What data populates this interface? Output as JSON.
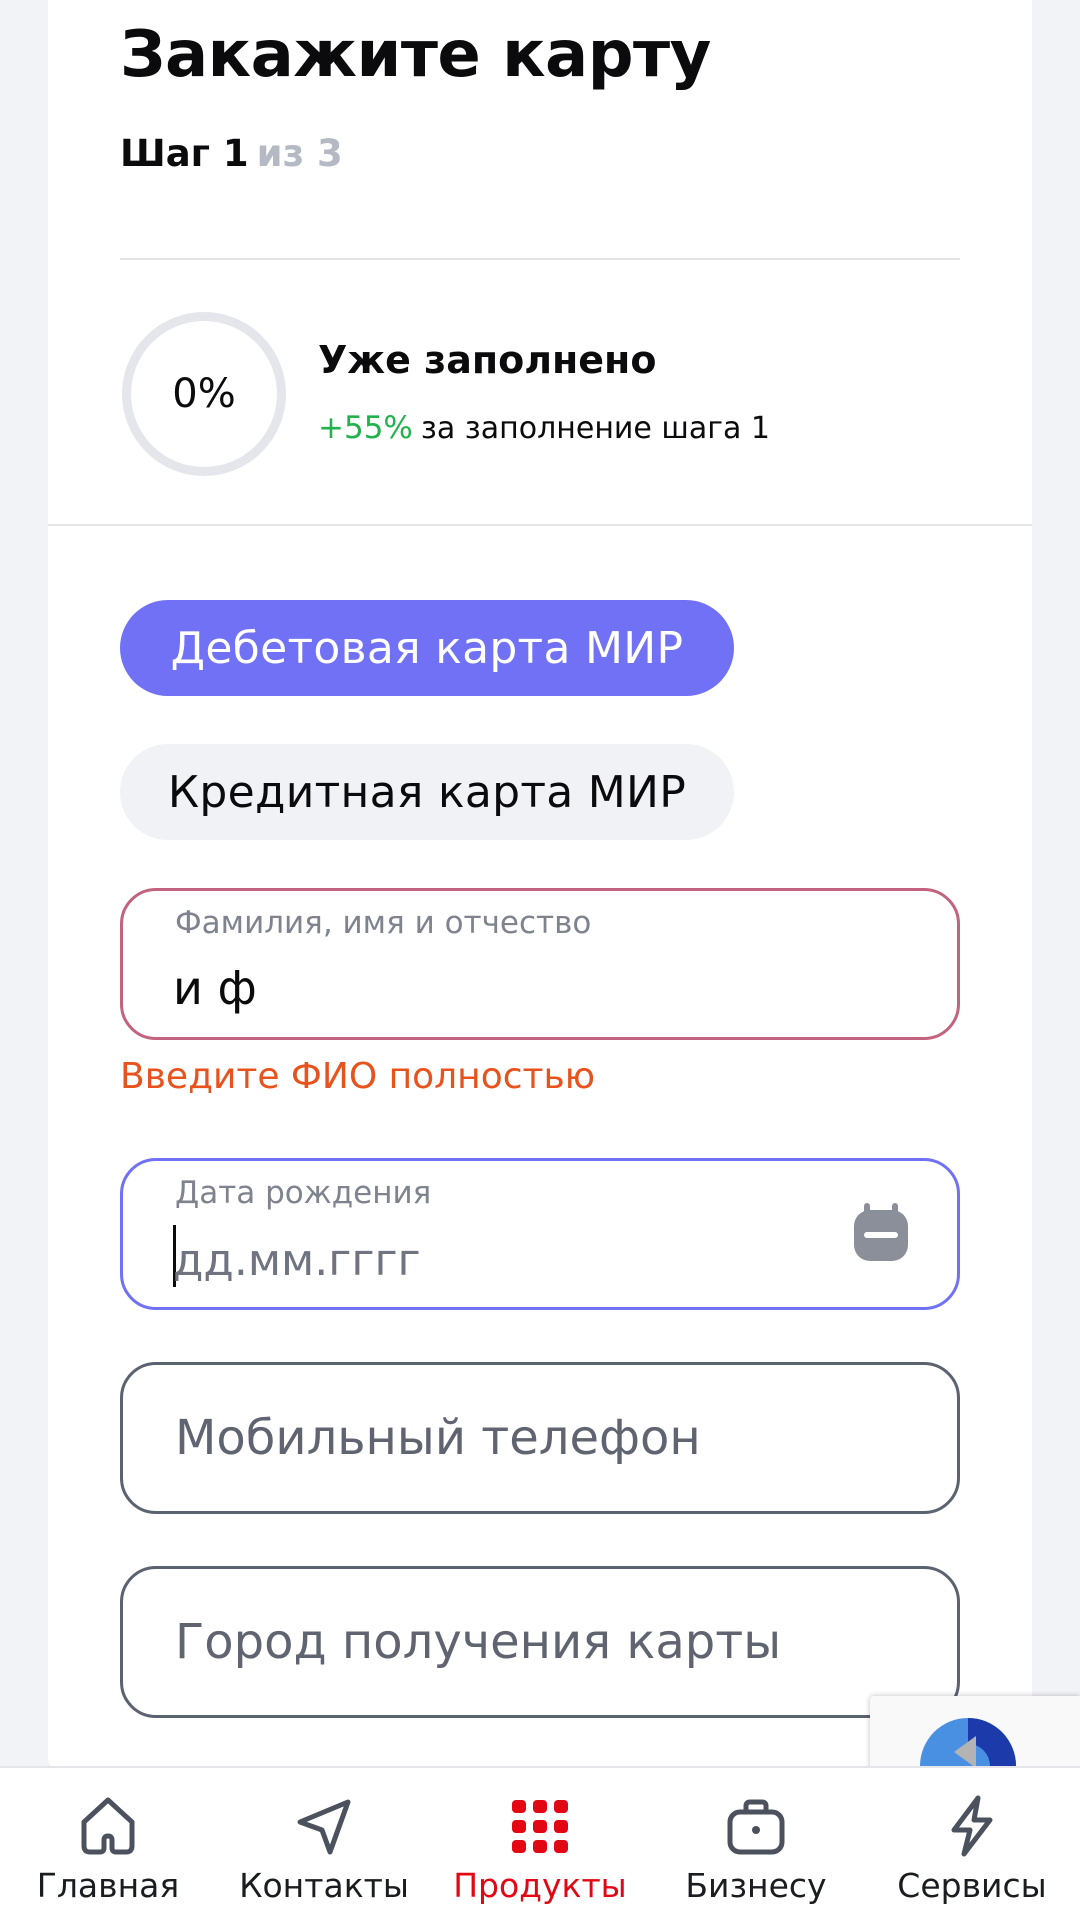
{
  "form": {
    "title": "Закажите карту",
    "step_label": "Шаг 1",
    "step_total": "из 3",
    "progress": {
      "percent_text": "0%",
      "value": 0,
      "title": "Уже заполнено",
      "bonus": "+55%",
      "bonus_text": "за заполнение шага 1"
    },
    "card_types": [
      {
        "label": "Дебетовая карта МИР",
        "selected": true
      },
      {
        "label": "Кредитная карта МИР",
        "selected": false
      }
    ],
    "fields": {
      "fio": {
        "label": "Фамилия, имя и отчество",
        "value": "и ф",
        "error": "Введите ФИО полностью"
      },
      "birth": {
        "label": "Дата рождения",
        "placeholder": "дд.мм.гггг"
      },
      "phone": {
        "placeholder": "Мобильный телефон"
      },
      "city": {
        "placeholder": "Город получения карты"
      }
    }
  },
  "bottom_nav": {
    "items": [
      {
        "label": "Главная",
        "icon": "home-icon"
      },
      {
        "label": "Контакты",
        "icon": "send-icon"
      },
      {
        "label": "Продукты",
        "icon": "grid-icon",
        "active": true
      },
      {
        "label": "Бизнесу",
        "icon": "briefcase-icon"
      },
      {
        "label": "Сервисы",
        "icon": "lightning-icon"
      }
    ]
  },
  "colors": {
    "accent": "#7171f5",
    "error": "#e8521c",
    "bonus": "#22b14c",
    "nav_active": "#e30613"
  }
}
